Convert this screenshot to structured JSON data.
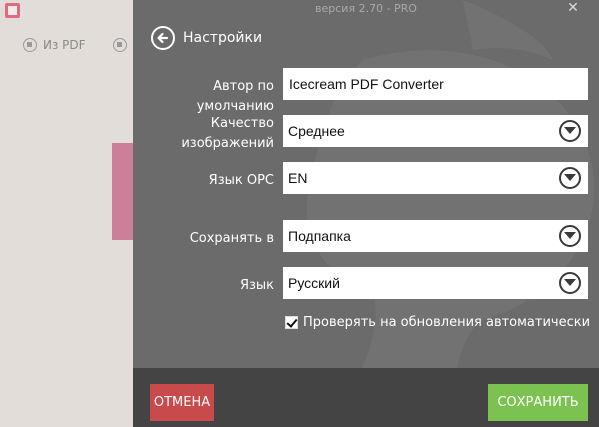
{
  "background_app": {
    "from_pdf_tab": "Из PDF"
  },
  "dialog": {
    "title_bar": "версия 2.70 - PRO",
    "close_icon": "close-icon",
    "back_icon": "back-arrow-icon",
    "heading": "Настройки",
    "fields": {
      "author": {
        "label": "Автор по умолчанию",
        "value": "Icecream PDF Converter"
      },
      "image_quality": {
        "label_line1": "Качество",
        "label_line2": "изображений",
        "value": "Среднее"
      },
      "ocr_language": {
        "label": "Язык OPC",
        "value": "EN"
      },
      "save_to": {
        "label": "Сохранять в",
        "value": "Подпапка"
      },
      "language": {
        "label": "Язык",
        "value": "Русский"
      }
    },
    "check_updates": {
      "label": "Проверять на обновления автоматически",
      "checked": true
    },
    "buttons": {
      "cancel": "ОТМЕНА",
      "save": "СОХРАНИТЬ"
    },
    "colors": {
      "dialog_bg": "#6b6b6b",
      "footer_bg": "#444444",
      "cancel": "#c94a4a",
      "save": "#7cc250"
    }
  }
}
